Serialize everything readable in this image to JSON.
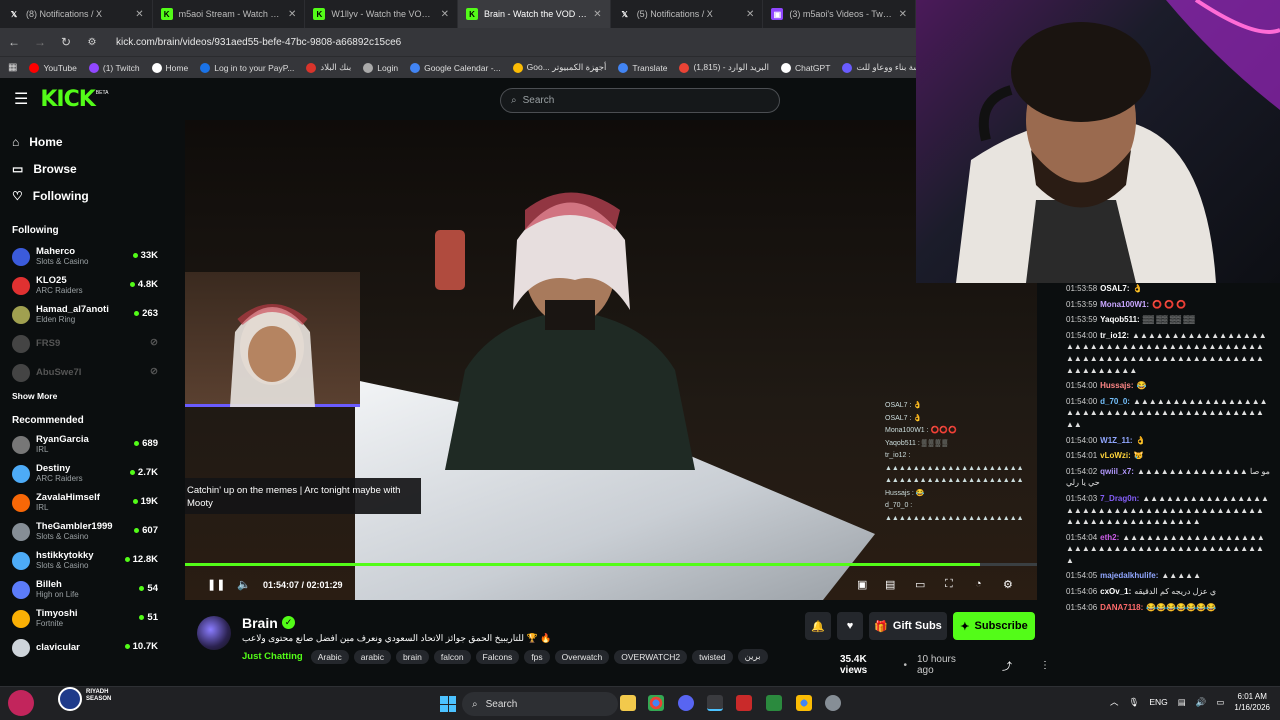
{
  "browser": {
    "tabs": [
      {
        "title": "(8) Notifications / X",
        "icon": "x",
        "active": false
      },
      {
        "title": "m5aoi Stream - Watch Live on Kick",
        "icon": "kick",
        "active": false
      },
      {
        "title": "W1llyv - Watch the VOD on Kick",
        "icon": "kick",
        "active": false
      },
      {
        "title": "Brain - Watch the VOD on Kick",
        "icon": "kick",
        "active": true
      },
      {
        "title": "(5) Notifications / X",
        "icon": "x",
        "active": false
      },
      {
        "title": "(3) m5aoi's Videos - Twitch",
        "icon": "twitch",
        "active": false
      }
    ],
    "url": "kick.com/brain/videos/931aed55-befe-47bc-9808-a66892c15ce6",
    "bookmarks": [
      {
        "label": "YouTube",
        "color": "#ff0000"
      },
      {
        "label": "(1) Twitch",
        "color": "#9147ff"
      },
      {
        "label": "Home",
        "color": "#ffffff"
      },
      {
        "label": "Log in to your PayP...",
        "color": "#1a73e8"
      },
      {
        "label": "بنك البلاد",
        "color": "#d9342b"
      },
      {
        "label": "Login",
        "color": "#aaaaaa"
      },
      {
        "label": "Google Calendar -...",
        "color": "#4285f4"
      },
      {
        "label": "Goo... أجهزة الكمبيوتر",
        "color": "#fbbc05"
      },
      {
        "label": "Translate",
        "color": "#4285f4"
      },
      {
        "label": "البريد الوارد - (1,815)",
        "color": "#ea4335"
      },
      {
        "label": "ChatGPT",
        "color": "#ffffff"
      },
      {
        "label": "مؤسسة بناء ووعاو للت...",
        "color": "#6a5cff"
      }
    ]
  },
  "kick": {
    "logo": "KICK",
    "logo_badge": "BETA",
    "search_placeholder": "Search",
    "nav": {
      "home": "Home",
      "browse": "Browse",
      "following": "Following"
    },
    "following_title": "Following",
    "following": [
      {
        "name": "Maherco",
        "category": "Slots & Casino",
        "viewers": "33K",
        "color": "#3b5bdb",
        "live": true
      },
      {
        "name": "KLO25",
        "category": "ARC Raiders",
        "viewers": "4.8K",
        "color": "#e03131",
        "live": true
      },
      {
        "name": "Hamad_al7anoti",
        "category": "Elden Ring",
        "viewers": "263",
        "color": "#a0a050",
        "live": true
      },
      {
        "name": "FRS9",
        "category": "",
        "viewers": "",
        "color": "#444",
        "live": false
      },
      {
        "name": "AbuSwe7l",
        "category": "",
        "viewers": "",
        "color": "#444",
        "live": false
      }
    ],
    "show_more": "Show More",
    "recommended_title": "Recommended",
    "recommended": [
      {
        "name": "RyanGarcia",
        "category": "IRL",
        "viewers": "689",
        "color": "#777"
      },
      {
        "name": "Destiny",
        "category": "ARC Raiders",
        "viewers": "2.7K",
        "color": "#4dabf7"
      },
      {
        "name": "ZavalaHimself",
        "category": "IRL",
        "viewers": "19K",
        "color": "#f76707"
      },
      {
        "name": "TheGambler1999",
        "category": "Slots & Casino",
        "viewers": "607",
        "color": "#868e96"
      },
      {
        "name": "hstikkytokky",
        "category": "Slots & Casino",
        "viewers": "12.8K",
        "color": "#4dabf7"
      },
      {
        "name": "Billeh",
        "category": "High on Life",
        "viewers": "54",
        "color": "#5c7cfa"
      },
      {
        "name": "Timyoshi",
        "category": "Fortnite",
        "viewers": "51",
        "color": "#fab005"
      },
      {
        "name": "clavicular",
        "category": "",
        "viewers": "10.7K",
        "color": "#ced4da"
      }
    ]
  },
  "video": {
    "caption": "Catchin' up on the memes | Arc tonight maybe with Mooty",
    "time": "01:54:07 / 02:01:29",
    "progress": 0.933,
    "overlay_chat": [
      "OSAL7 : 👌",
      "OSAL7 : 👌",
      "Mona100W1 : ⭕⭕⭕",
      "Yaqob511 : ▒ ▒ ▒ ▒",
      "tr_io12 :",
      "▲▲▲▲▲▲▲▲▲▲▲▲▲▲▲▲▲▲▲▲",
      "▲▲▲▲▲▲▲▲▲▲▲▲▲▲▲▲▲▲▲▲",
      "Hussajs : 😂",
      "d_70_0 :",
      "▲▲▲▲▲▲▲▲▲▲▲▲▲▲▲▲▲▲▲▲"
    ]
  },
  "stream": {
    "streamer": "Brain",
    "title": "🔥 🏆 للتاريبيخ الحمق جوائز الاتحاد السعودي ونعرف مين افضل صانع محتوى ولاعب",
    "category": "Just Chatting",
    "tags": [
      "Arabic",
      "arabic",
      "brain",
      "falcon",
      "Falcons",
      "fps",
      "Overwatch",
      "OVERWATCH2",
      "twisted",
      "برين"
    ],
    "views": "35.4K views",
    "when": "10 hours ago",
    "gift_label": "Gift Subs",
    "subscribe_label": "Subscribe"
  },
  "chat": [
    {
      "ts": "01:53:58",
      "user": "OSAL7:",
      "color": "#ffffff",
      "text": "👌"
    },
    {
      "ts": "01:53:59",
      "user": "Mona100W1:",
      "color": "#c9a7ff",
      "text": "⭕ ⭕ ⭕"
    },
    {
      "ts": "01:53:59",
      "user": "Yaqob511:",
      "color": "#ffffff",
      "text": "▒▒ ▒▒ ▒▒ ▒▒"
    },
    {
      "ts": "01:54:00",
      "user": "tr_io12:",
      "color": "#ffffff",
      "text": "▲▲▲▲▲▲▲▲▲▲▲▲▲▲▲▲▲▲▲▲▲▲▲▲▲▲▲▲▲▲▲▲▲▲▲▲▲▲▲▲▲▲▲▲▲▲▲▲▲▲▲▲▲▲▲▲▲▲▲▲▲▲▲▲▲▲▲▲▲▲▲▲▲▲▲▲"
    },
    {
      "ts": "01:54:00",
      "user": "Hussajs:",
      "color": "#ff8787",
      "text": "😂"
    },
    {
      "ts": "01:54:00",
      "user": "d_70_0:",
      "color": "#74c0fc",
      "text": "▲▲▲▲▲▲▲▲▲▲▲▲▲▲▲▲▲▲▲▲▲▲▲▲▲▲▲▲▲▲▲▲▲▲▲▲▲▲▲▲▲▲▲▲"
    },
    {
      "ts": "01:54:00",
      "user": "W1Z_11:",
      "color": "#91a7ff",
      "text": "👌"
    },
    {
      "ts": "01:54:01",
      "user": "vLoWzi:",
      "color": "#ffd43b",
      "text": "😿"
    },
    {
      "ts": "01:54:02",
      "user": "qwiil_x7:",
      "color": "#b197fc",
      "text": "▲▲▲▲▲▲▲▲▲▲▲▲▲▲ مو صاحي يا رلي"
    },
    {
      "ts": "01:54:03",
      "user": "7_Drag0n:",
      "color": "#845ef7",
      "text": "▲▲▲▲▲▲▲▲▲▲▲▲▲▲▲▲▲▲▲▲▲▲▲▲▲▲▲▲▲▲▲▲▲▲▲▲▲▲▲▲▲▲▲▲▲▲▲▲▲▲▲▲▲▲▲▲▲▲"
    },
    {
      "ts": "01:54:04",
      "user": "eth2:",
      "color": "#cc5de8",
      "text": "▲▲▲▲▲▲▲▲▲▲▲▲▲▲▲▲▲▲▲▲▲▲▲▲▲▲▲▲▲▲▲▲▲▲▲▲▲▲▲▲▲▲▲▲"
    },
    {
      "ts": "01:54:05",
      "user": "majedalkhulife:",
      "color": "#91a7ff",
      "text": "▲▲▲▲▲"
    },
    {
      "ts": "01:54:06",
      "user": "cxOv_1:",
      "color": "#ffffff",
      "text": "ي عزل دريجه كم الدقيقه"
    },
    {
      "ts": "01:54:06",
      "user": "DANA7118:",
      "color": "#ff6b6b",
      "text": "😂😂😂😂😂😂😂"
    }
  ],
  "taskbar": {
    "search": "Search",
    "lang": "ENG",
    "time": "6:01 AM",
    "date": "1/16/2026",
    "riyadh": "RIYADH SEASON"
  }
}
